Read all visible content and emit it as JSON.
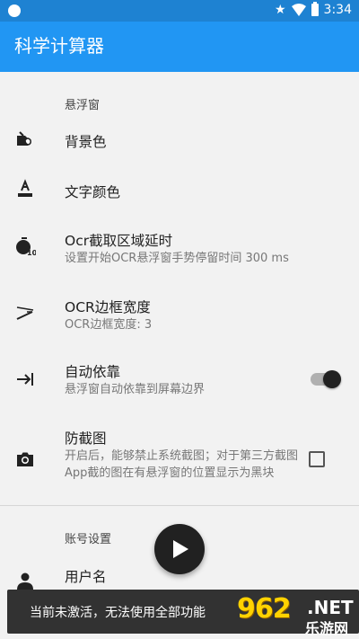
{
  "status_bar": {
    "time": "3:34"
  },
  "app_bar": {
    "title": "科学计算器"
  },
  "sections": {
    "float_window": "悬浮窗",
    "account": "账号设置"
  },
  "items": {
    "background_color": {
      "title": "背景色"
    },
    "text_color": {
      "title": "文字颜色"
    },
    "ocr_delay": {
      "title": "Ocr截取区域延时",
      "summary": "设置开始OCR悬浮窗手势停留时间 300 ms"
    },
    "ocr_border": {
      "title": "OCR边框宽度",
      "summary": "OCR边框宽度: 3"
    },
    "auto_dock": {
      "title": "自动依靠",
      "summary": "悬浮窗自动依靠到屏幕边界",
      "enabled": true
    },
    "anti_screenshot": {
      "title": "防截图",
      "summary": "开启后，能够禁止系统截图；对于第三方截图App截的图在有悬浮窗的位置显示为黑块",
      "checked": false
    },
    "username": {
      "title": "用户名"
    }
  },
  "snackbar": {
    "message": "当前未激活，无法使用全部功能"
  },
  "watermark": {
    "number": "962",
    "domain": ".NET",
    "name": "乐游网"
  },
  "colors": {
    "primary": "#2196f3",
    "status_bar": "#1e82d2",
    "fab": "#212121",
    "snackbar": "#323232"
  }
}
